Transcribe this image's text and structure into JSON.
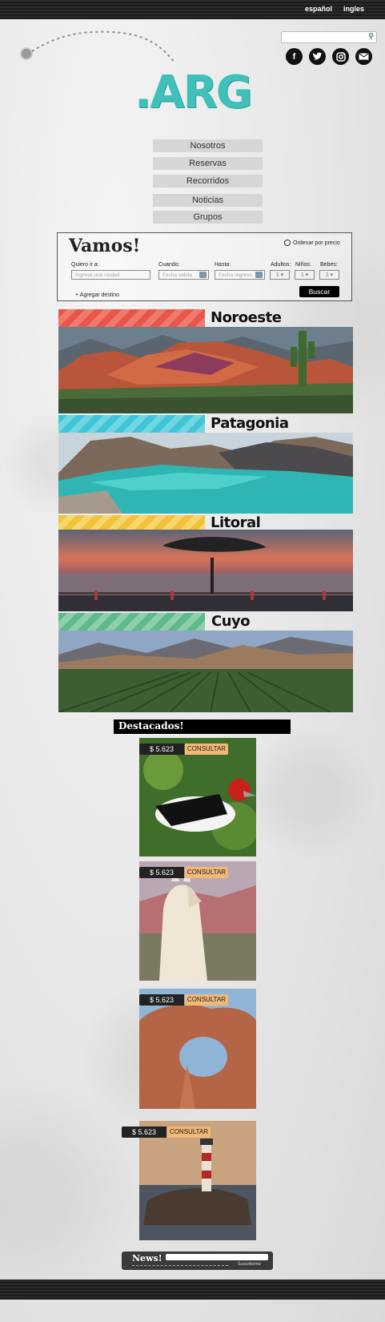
{
  "header": {
    "lang_es": "español",
    "lang_en": "ingles",
    "search_placeholder": "",
    "social": [
      "facebook-icon",
      "twitter-icon",
      "instagram-icon",
      "mail-icon"
    ]
  },
  "logo": {
    "text": ".ARG",
    "color": "#3fc0bb"
  },
  "nav": [
    "Nosotros",
    "Reservas",
    "Recorridos",
    "Noticias",
    "Grupos"
  ],
  "booking": {
    "title": "Vamos!",
    "order_by_price": "Ordenar por precio",
    "destination_label": "Quiero ir a:",
    "destination_placeholder": "Ingrese una ciudad",
    "when_label": "Cuando:",
    "when_placeholder": "Fecha salida",
    "until_label": "Hasta:",
    "until_placeholder": "Fecha regreso",
    "adults_label": "Adultos:",
    "adults_value": "1",
    "kids_label": "Niños:",
    "kids_value": "1",
    "babies_label": "Bebes:",
    "babies_value": "1",
    "add_destination": "+ Agregar destino",
    "search_button": "Buscar"
  },
  "regions": [
    {
      "name": "Noroeste",
      "color": "#e8564a"
    },
    {
      "name": "Patagonia",
      "color": "#3fc6d6"
    },
    {
      "name": "Litoral",
      "color": "#f2c23a"
    },
    {
      "name": "Cuyo",
      "color": "#5fb98a"
    }
  ],
  "featured": {
    "title": "Destacados!",
    "items": [
      {
        "price": "$ 5.623",
        "action": "CONSULTAR",
        "subject": "woodpecker"
      },
      {
        "price": "$ 5.623",
        "action": "CONSULTAR",
        "subject": "llama"
      },
      {
        "price": "$ 5.623",
        "action": "CONSULTAR",
        "subject": "rock-arch"
      },
      {
        "price": "$ 5.623",
        "action": "CONSULTAR",
        "subject": "lighthouse"
      }
    ]
  },
  "newsletter": {
    "title": "News!",
    "subscribe": "Suscribirme"
  }
}
